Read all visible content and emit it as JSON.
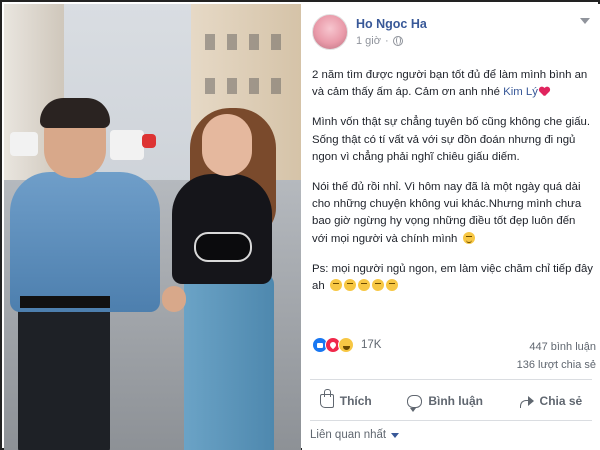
{
  "post": {
    "author": "Ho Ngoc Ha",
    "time": "1 giờ",
    "privacy_icon": "globe-icon",
    "paragraphs": {
      "p1_text": "2 năm tìm được người bạn tốt đủ để làm mình bình an và cảm thấy ấm áp. Cảm ơn anh nhé ",
      "p1_tag": "Kim Lý",
      "p2": "Mình vốn thật sự chẳng tuyên bố cũng không che giấu. Sống thật có tí vất vả với sự đồn đoán nhưng đi ngủ ngon vì chẳng phải nghĩ chiêu giấu diếm.",
      "p3": "Nói thế đủ rồi nhỉ. Vì hôm nay đã là một ngày quá dài cho những chuyện không vui khác.Nhưng mình chưa bao giờ ngừng hy vọng những điều tốt đẹp luôn đến với mọi người và chính mình",
      "p4": "Ps: mọi người ngủ ngon, em làm việc chăm chỉ tiếp đây ah"
    },
    "reactions": {
      "icons": [
        "like-icon",
        "love-icon",
        "haha-icon"
      ],
      "count": "17K"
    },
    "comments": "447 bình luận",
    "shares": "136 lượt chia sẻ",
    "actions": {
      "like": "Thích",
      "comment": "Bình luận",
      "share": "Chia sẻ"
    },
    "sort_label": "Liên quan nhất"
  },
  "colors": {
    "link": "#385898",
    "muted": "#606770",
    "heart": "#e0245e",
    "like": "#1877f2"
  }
}
